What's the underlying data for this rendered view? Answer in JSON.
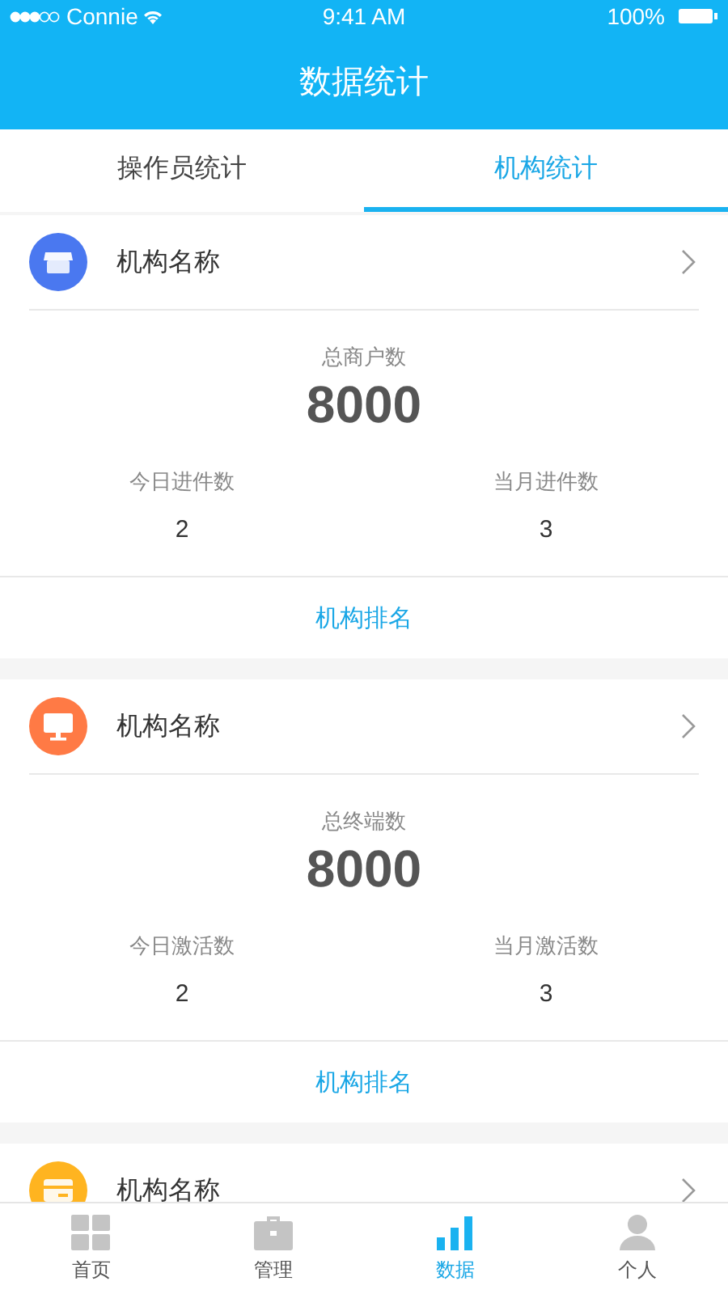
{
  "status_bar": {
    "carrier": "Connie",
    "time": "9:41 AM",
    "battery": "100%"
  },
  "header": {
    "title": "数据统计"
  },
  "tabs": [
    {
      "label": "操作员统计",
      "selected": false
    },
    {
      "label": "机构统计",
      "selected": true
    }
  ],
  "cards": [
    {
      "color": "#4a78f0",
      "name": "机构名称",
      "total_label": "总商户数",
      "total": "8000",
      "stats": [
        {
          "label": "今日进件数",
          "value": "2"
        },
        {
          "label": "当月进件数",
          "value": "3"
        }
      ],
      "link": "机构排名"
    },
    {
      "color": "#ff7a45",
      "name": "机构名称",
      "total_label": "总终端数",
      "total": "8000",
      "stats": [
        {
          "label": "今日激活数",
          "value": "2"
        },
        {
          "label": "当月激活数",
          "value": "3"
        }
      ],
      "link": "机构排名"
    },
    {
      "color": "#ffb420",
      "name": "机构名称"
    }
  ],
  "bottom_nav": [
    {
      "label": "首页",
      "selected": false
    },
    {
      "label": "管理",
      "selected": false
    },
    {
      "label": "数据",
      "selected": true
    },
    {
      "label": "个人",
      "selected": false
    }
  ]
}
